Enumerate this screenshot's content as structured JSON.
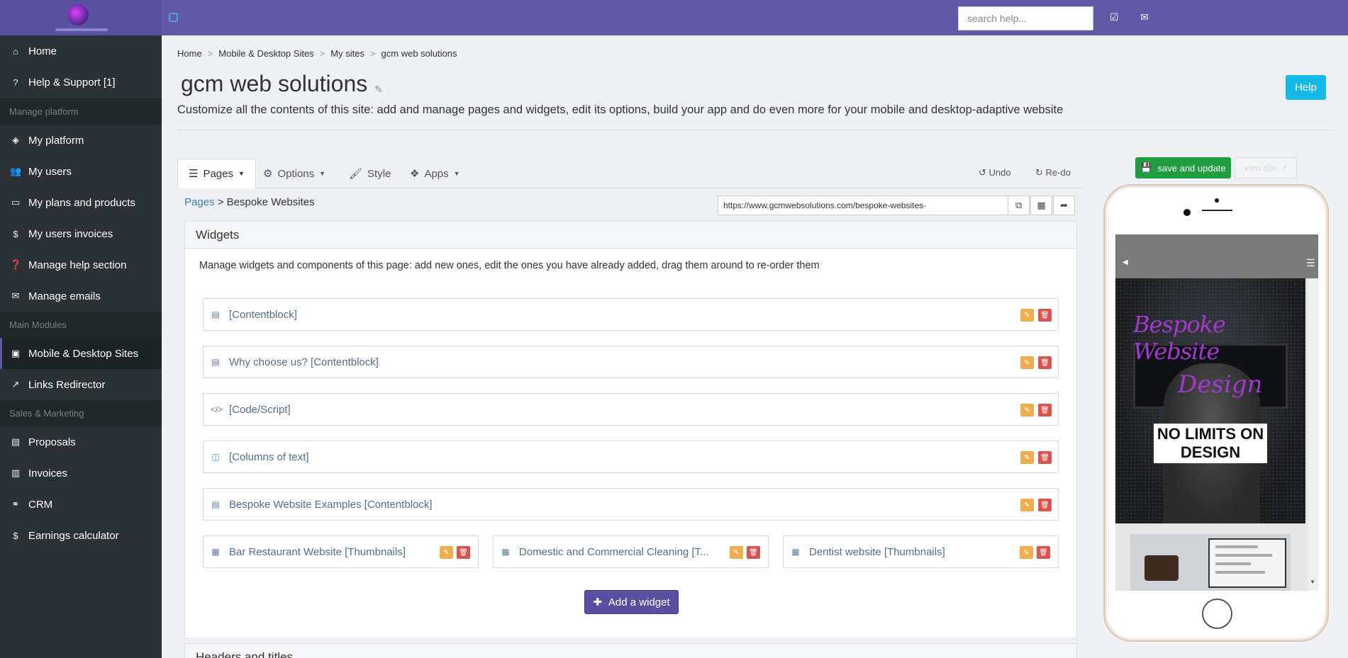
{
  "topbar": {
    "search_placeholder": "search help...",
    "icons": [
      "check-square-icon",
      "envelope-icon"
    ]
  },
  "sidebar": {
    "items": [
      {
        "label": "Home",
        "icon": "home-icon"
      },
      {
        "label": "Help & Support [1]",
        "icon": "question-icon"
      },
      {
        "label": "My platform",
        "icon": "cube-icon"
      },
      {
        "label": "My users",
        "icon": "users-icon"
      },
      {
        "label": "My plans and products",
        "icon": "credit-card-icon"
      },
      {
        "label": "My users invoices",
        "icon": "dollar-icon"
      },
      {
        "label": "Manage help section",
        "icon": "question-circle-icon"
      },
      {
        "label": "Manage emails",
        "icon": "envelope-icon"
      },
      {
        "label": "Mobile & Desktop Sites",
        "icon": "desktop-icon"
      },
      {
        "label": "Links Redirector",
        "icon": "external-link-icon"
      },
      {
        "label": "Proposals",
        "icon": "file-icon"
      },
      {
        "label": "Invoices",
        "icon": "money-icon"
      },
      {
        "label": "CRM",
        "icon": "handshake-icon"
      },
      {
        "label": "Earnings calculator",
        "icon": "dollar-icon"
      }
    ],
    "sections": [
      "Manage platform",
      "Main Modules",
      "Sales & Marketing"
    ]
  },
  "breadcrumb": [
    "Home",
    "Mobile & Desktop Sites",
    "My sites",
    "gcm web solutions"
  ],
  "page": {
    "title": "gcm web solutions",
    "subtitle": "Customize all the contents of this site: add and manage pages and widgets, edit its options, build your app and do even more for your mobile and desktop-adaptive website",
    "help_label": "Help"
  },
  "tabs": [
    {
      "label": "Pages"
    },
    {
      "label": "Options"
    },
    {
      "label": "Style"
    },
    {
      "label": "Apps"
    }
  ],
  "actions": {
    "undo": "Undo",
    "redo": "Re-do"
  },
  "page_crumb": {
    "link": "Pages",
    "current": "> Bespoke Websites"
  },
  "url": "https://www.gcmwebsolutions.com/bespoke-websites-",
  "widgets_panel": {
    "title": "Widgets",
    "description": "Manage widgets and components of this page: add new ones, edit the ones you have already added, drag them around to re-order them",
    "items": [
      {
        "label": "[Contentblock]",
        "icon": "contentblock-icon"
      },
      {
        "label": "Why choose us? [Contentblock]",
        "icon": "contentblock-icon"
      },
      {
        "label": "[Code/Script]",
        "icon": "code-icon"
      },
      {
        "label": "[Columns of text]",
        "icon": "columns-icon"
      },
      {
        "label": "Bespoke Website Examples [Contentblock]",
        "icon": "contentblock-icon"
      }
    ],
    "thumbnails": [
      {
        "label": "Bar Restaurant Website [Thumbnails]"
      },
      {
        "label": "Domestic and Commercial Cleaning [T..."
      },
      {
        "label": "Dentist website [Thumbnails]"
      }
    ],
    "add_label": "Add a widget"
  },
  "next_panel_title": "Headers and titles",
  "preview": {
    "save_label": "save and update",
    "view_label": "view site",
    "hero_text": "NO LIMITS ON DESIGN",
    "hero_script_1": "Bespoke Website",
    "hero_script_2": "Design"
  },
  "colors": {
    "topbar": "#6258a8",
    "sidebar": "#2b3135",
    "help": "#14b9e8",
    "save": "#1e9e3e",
    "add_widget": "#5a4fa0",
    "edit": "#f0ad4e",
    "delete": "#d9534f"
  }
}
